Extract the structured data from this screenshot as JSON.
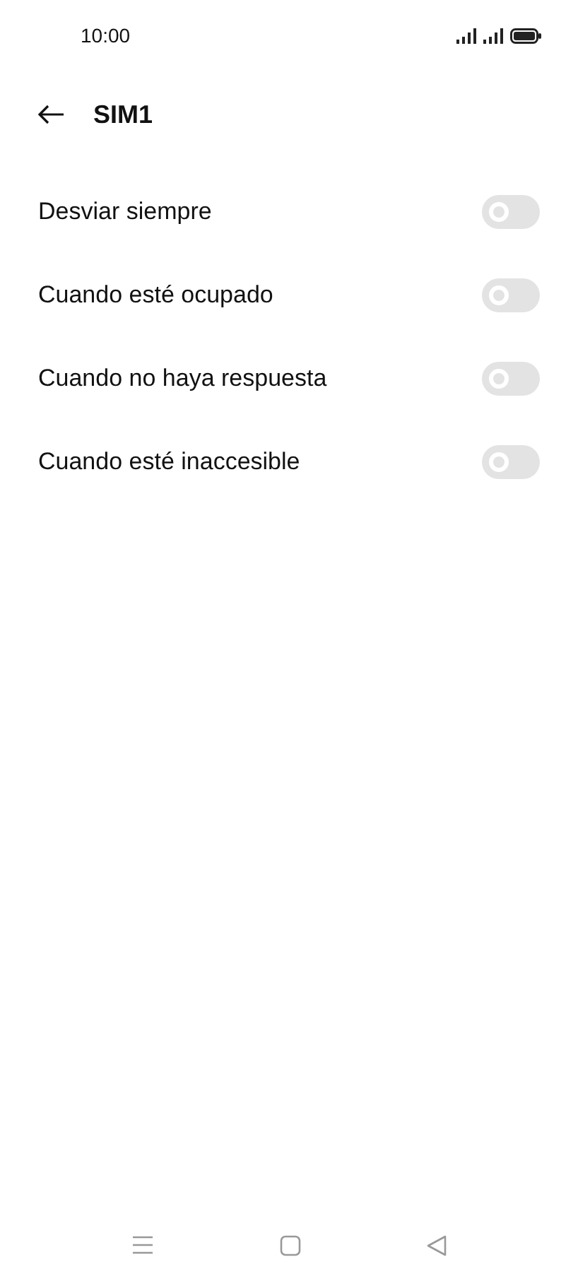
{
  "status_bar": {
    "time": "10:00"
  },
  "header": {
    "title": "SIM1"
  },
  "settings": [
    {
      "label": "Desviar siempre",
      "on": false,
      "disabled": true
    },
    {
      "label": "Cuando esté ocupado",
      "on": false,
      "disabled": true
    },
    {
      "label": "Cuando no haya respuesta",
      "on": false,
      "disabled": true
    },
    {
      "label": "Cuando esté inaccesible",
      "on": false,
      "disabled": true
    }
  ]
}
